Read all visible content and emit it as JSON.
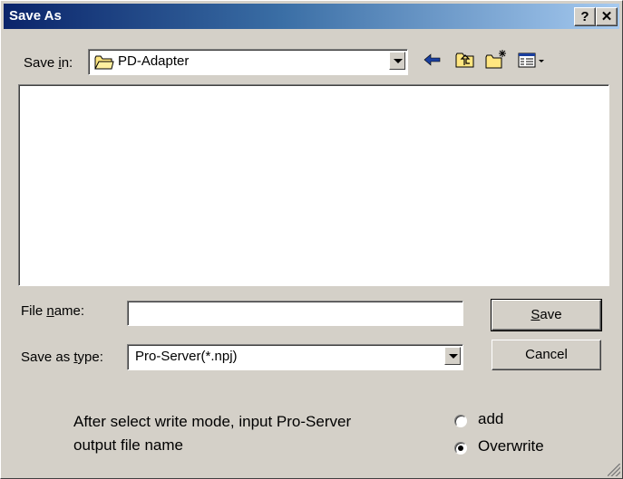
{
  "window": {
    "title": "Save As"
  },
  "title_buttons": {
    "help": "?",
    "close": "✕"
  },
  "save_in": {
    "label_prefix": "Save ",
    "label_underlined": "i",
    "label_suffix": "n:",
    "value": "PD-Adapter"
  },
  "toolbar": {
    "icons": [
      "back-arrow-icon",
      "up-one-level-icon",
      "new-folder-icon",
      "view-menu-icon"
    ]
  },
  "file_name": {
    "label_prefix": "File ",
    "label_underlined": "n",
    "label_suffix": "ame:",
    "value": ""
  },
  "save_as_type": {
    "label_prefix": "Save as ",
    "label_underlined": "t",
    "label_suffix": "ype:",
    "value": "Pro-Server(*.npj)"
  },
  "buttons": {
    "save_underlined": "S",
    "save_rest": "ave",
    "cancel": "Cancel"
  },
  "instructions": {
    "line1": "After select write mode, input Pro-Server",
    "line2": "output file name"
  },
  "write_mode": {
    "options": [
      {
        "label": "add",
        "selected": false
      },
      {
        "label": "Overwrite",
        "selected": true
      }
    ]
  },
  "colors": {
    "titlebar_start": "#0a246a",
    "titlebar_end": "#a6caf0",
    "face": "#d4d0c8"
  }
}
